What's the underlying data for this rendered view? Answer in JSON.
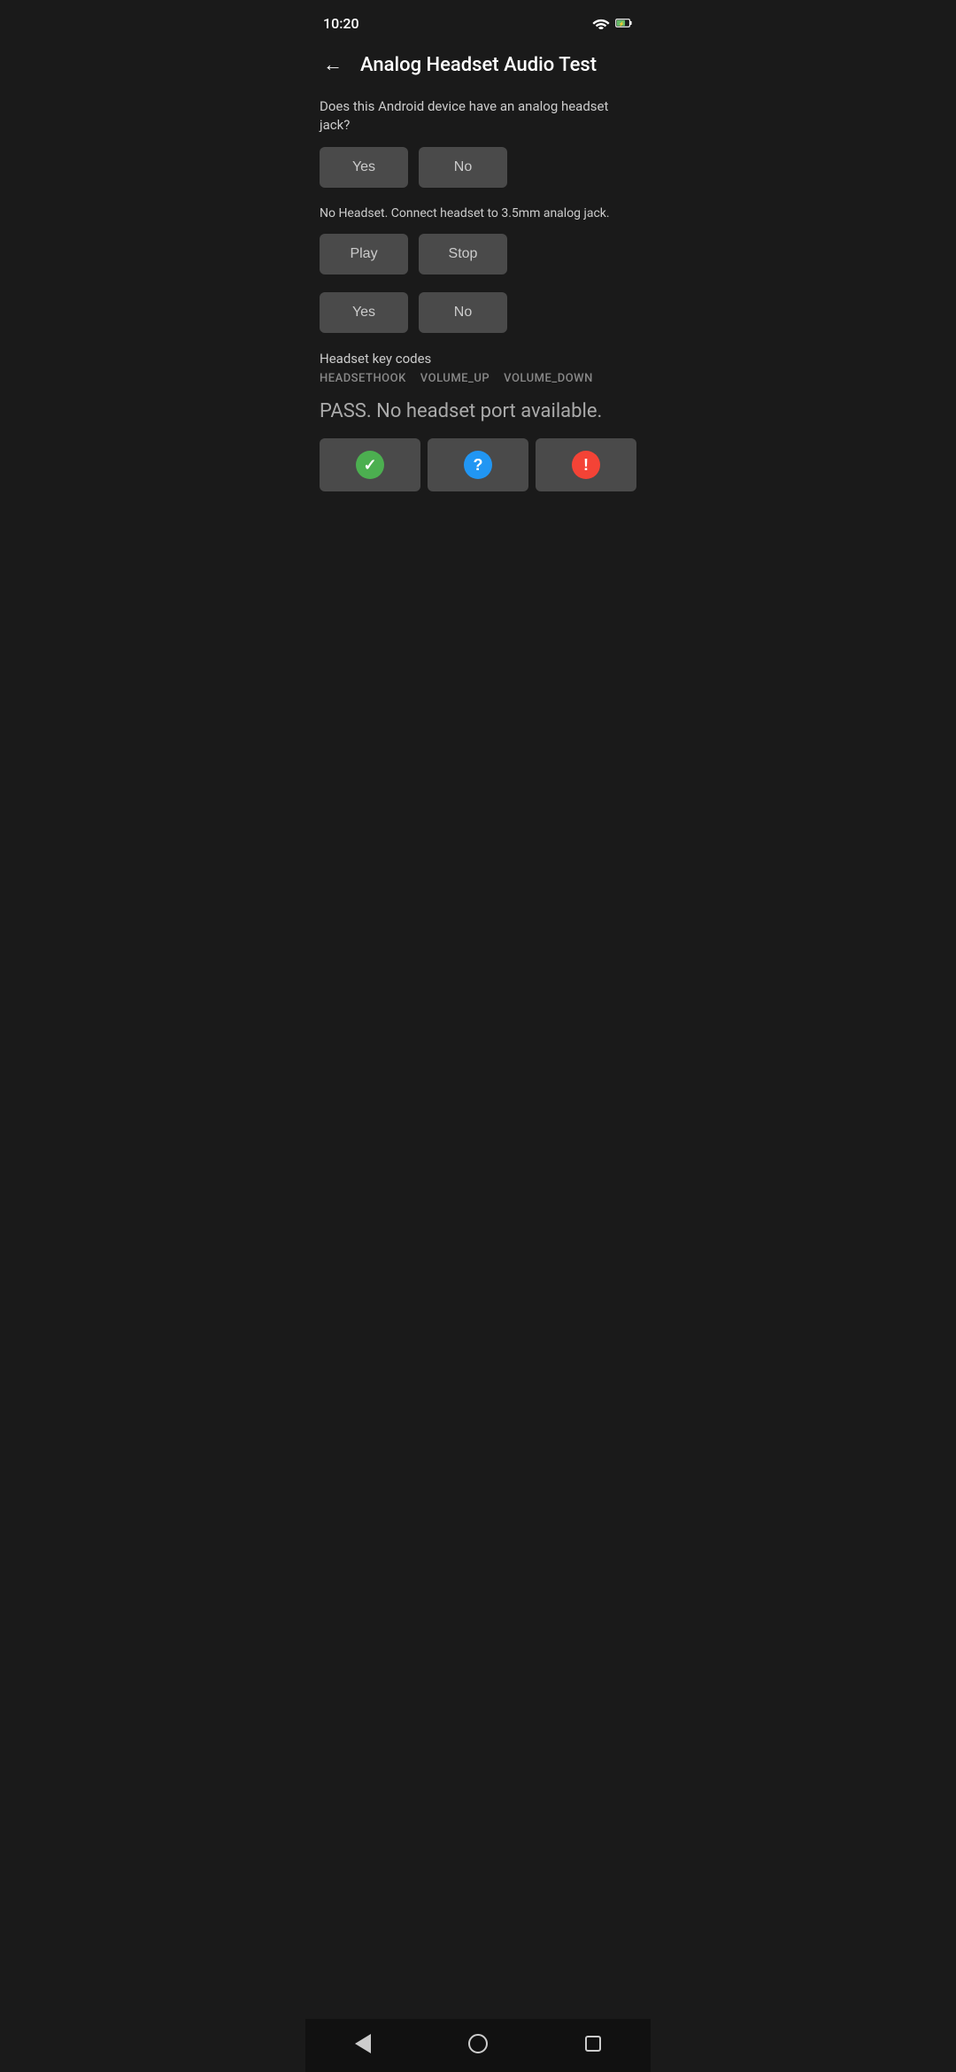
{
  "statusBar": {
    "time": "10:20"
  },
  "toolbar": {
    "backLabel": "←",
    "title": "Analog Headset Audio Test"
  },
  "section1": {
    "question": "Does this Android device have an analog headset jack?",
    "yesLabel": "Yes",
    "noLabel": "No"
  },
  "section2": {
    "info": "No Headset. Connect headset to 3.5mm analog jack.",
    "playLabel": "Play",
    "stopLabel": "Stop"
  },
  "section3": {
    "yesLabel": "Yes",
    "noLabel": "No"
  },
  "keyCodes": {
    "label": "Headset key codes",
    "codes": [
      "HEADSETHOOK",
      "VOLUME_UP",
      "VOLUME_DOWN"
    ]
  },
  "passText": "PASS. No headset port available.",
  "resultButtons": {
    "passIcon": "✓",
    "infoIcon": "?",
    "failIcon": "!"
  },
  "navBar": {}
}
